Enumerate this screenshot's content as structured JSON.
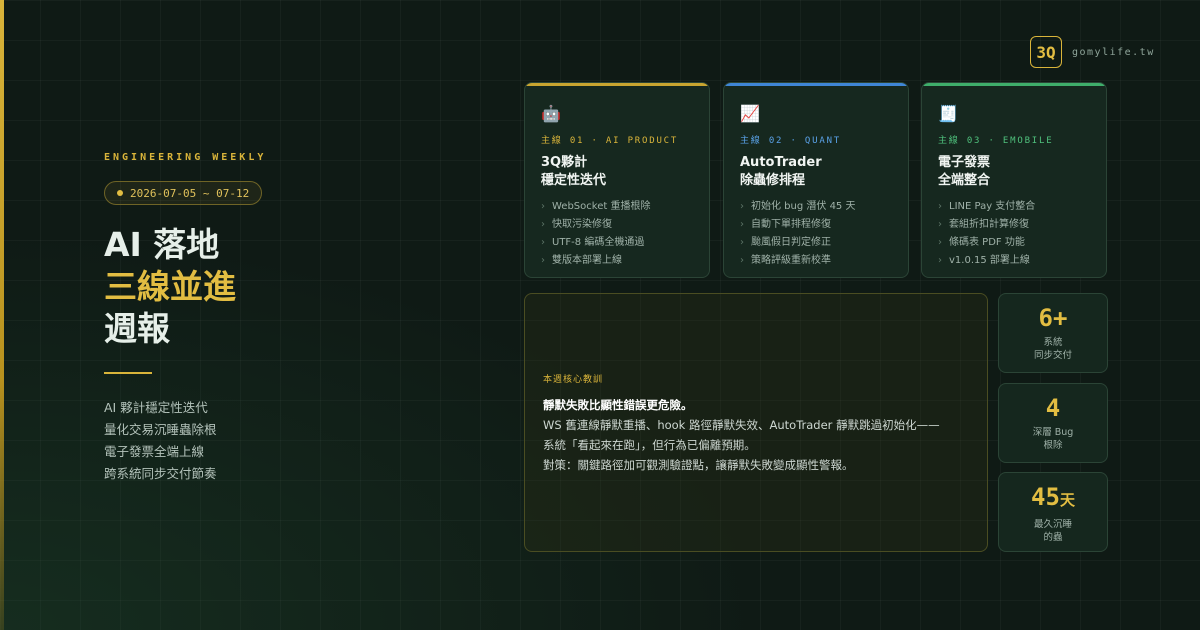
{
  "brand": {
    "logo": "3Q",
    "domain": "gomylife.tw"
  },
  "header": {
    "kicker": "ENGINEERING WEEKLY",
    "date_range": "2026-07-05 ~ 07-12",
    "title_line1": "AI 落地",
    "title_line2": "三線並進",
    "title_line3": "週報"
  },
  "summary": [
    "AI 夥計穩定性迭代",
    "量化交易沉睡蟲除根",
    "電子發票全端上線",
    "跨系統同步交付節奏"
  ],
  "colors": {
    "accent_gold": "#d9b43a",
    "accent_ai": "#c9a530",
    "accent_quant": "#3f86d6",
    "accent_emobile": "#3fae6b"
  },
  "cards": [
    {
      "icon": "robot-icon",
      "emoji": "🤖",
      "tag": "主線 01 · AI PRODUCT",
      "title_line1": "3Q夥計",
      "title_line2": "穩定性迭代",
      "items": [
        "WebSocket 重播根除",
        "快取污染修復",
        "UTF-8 編碼全機通過",
        "雙版本部署上線"
      ]
    },
    {
      "icon": "chart-increasing-icon",
      "emoji": "📈",
      "tag": "主線 02 · QUANT",
      "title_line1": "AutoTrader",
      "title_line2": "除蟲修排程",
      "items": [
        "初始化 bug 潛伏 45 天",
        "自動下單排程修復",
        "颱風假日判定修正",
        "策略評級重新校準"
      ]
    },
    {
      "icon": "receipt-icon",
      "emoji": "🧾",
      "tag": "主線 03 · EMOBILE",
      "title_line1": "電子發票",
      "title_line2": "全端整合",
      "items": [
        "LINE Pay 支付整合",
        "套組折扣計算修復",
        "條碼表 PDF 功能",
        "v1.0.15 部署上線"
      ]
    }
  ],
  "lesson": {
    "label": "本週核心教訓",
    "lead": "靜默失敗比顯性錯誤更危險。",
    "body_line1": "WS 舊連線靜默重播、hook 路徑靜默失效、AutoTrader 靜默跳過初始化——",
    "body_line2": "系統「看起來在跑」，但行為已偏離預期。",
    "body_line3": "對策：關鍵路徑加可觀測驗證點，讓靜默失敗變成顯性警報。"
  },
  "stats": [
    {
      "value": "6+",
      "unit": "",
      "label_line1": "系統",
      "label_line2": "同步交付"
    },
    {
      "value": "4",
      "unit": "",
      "label_line1": "深層 Bug",
      "label_line2": "根除"
    },
    {
      "value": "45",
      "unit": "天",
      "label_line1": "最久沉睡",
      "label_line2": "的蟲"
    }
  ]
}
